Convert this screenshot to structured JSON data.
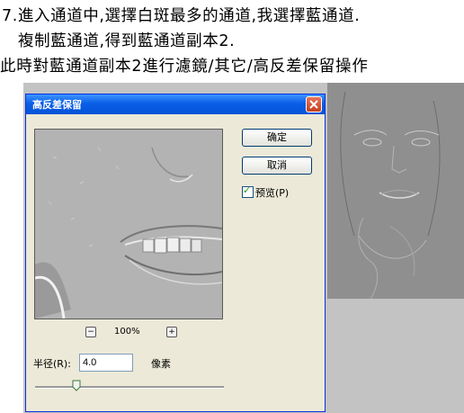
{
  "caption": {
    "line1": "7.進入通道中,選擇白斑最多的通道,我選擇藍通道.",
    "line2": "複制藍通道,得到藍通道副本2.",
    "line3": "此時對藍通道副本2進行濾鏡/其它/高反差保留操作"
  },
  "dialog": {
    "title": "高反差保留",
    "ok_label": "确定",
    "cancel_label": "取消",
    "preview_label": "预览(P)",
    "preview_checked": true,
    "zoom": {
      "out_label": "−",
      "value": "100%",
      "in_label": "+"
    },
    "radius": {
      "label": "半径(R):",
      "value": "4.0",
      "unit": "像素",
      "slider_fraction": 0.22
    }
  },
  "icons": {
    "close": "close-icon",
    "check": "checkmark-icon"
  }
}
